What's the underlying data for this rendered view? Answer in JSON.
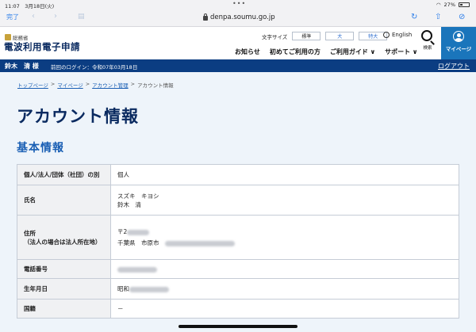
{
  "status": {
    "time": "11:07",
    "date": "3月18日(火)",
    "battery": "27%"
  },
  "browser": {
    "done_label": "完了",
    "url": "denpa.soumu.go.jp"
  },
  "header": {
    "org": "総務省",
    "title": "電波利用電子申請",
    "font_size_label": "文字サイズ",
    "font_sizes": [
      "標準",
      "大",
      "特大"
    ],
    "english": "English",
    "nav": [
      "お知らせ",
      "初めてご利用の方",
      "ご利用ガイド ∨",
      "サポート ∨"
    ],
    "search_label": "検索",
    "mypage_label": "マイページ"
  },
  "userbar": {
    "name": "鈴木　清 様",
    "last_login": "前回のログイン：令和07年03月18日",
    "logout": "ログアウト"
  },
  "breadcrumb": {
    "home": "トップページ",
    "mypage": "マイページ",
    "account": "アカウント管理",
    "current": "アカウント情報",
    "sep": ">"
  },
  "page": {
    "title": "アカウント情報",
    "section": "基本情報"
  },
  "table": {
    "type_label": "個人/法人/団体（社団）の別",
    "type_value": "個人",
    "name_label": "氏名",
    "name_kana": "スズキ　キヨシ",
    "name_kanji": "鈴木　清",
    "address_label_1": "住所",
    "address_label_2": "（法人の場合は法人所在地）",
    "zip_prefix": "〒2",
    "address_prefecture": "千葉県　市原市",
    "phone_label": "電話番号",
    "birth_label": "生年月日",
    "birth_prefix": "昭和",
    "nation_label": "国籍",
    "nation_value": "－"
  },
  "colors": {
    "brand_navy": "#0b3d82",
    "link_blue": "#1a5fb4",
    "mypage_blue": "#1a75bb"
  }
}
